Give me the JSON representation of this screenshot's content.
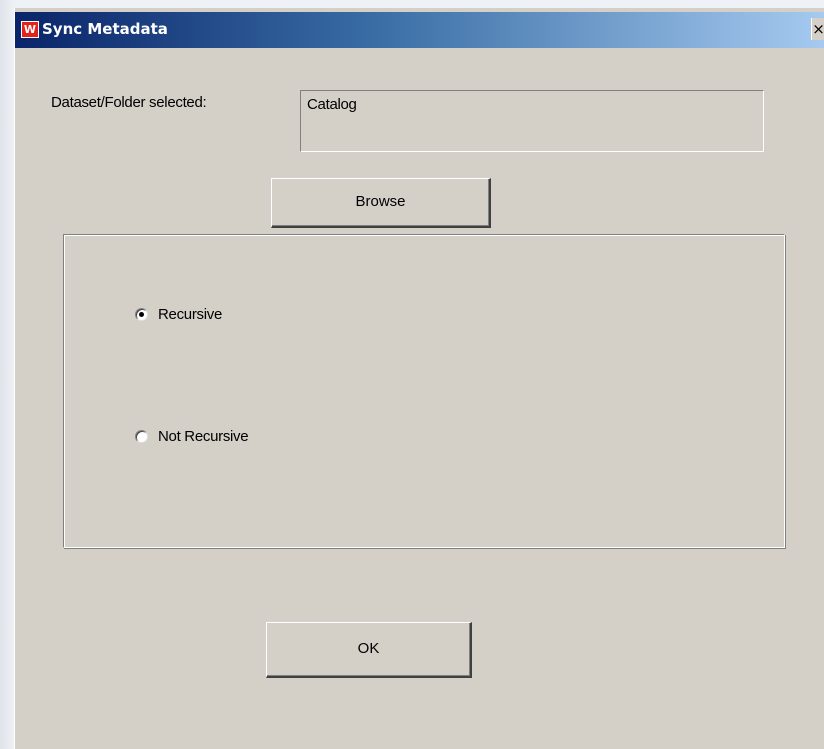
{
  "window": {
    "title": "Sync Metadata",
    "app_icon_glyph": "W",
    "close_glyph": "×"
  },
  "form": {
    "selected_label": "Dataset/Folder selected:",
    "selected_value": "Catalog",
    "browse_label": "Browse",
    "ok_label": "OK"
  },
  "options": {
    "recursive_label": "Recursive",
    "not_recursive_label": "Not Recursive",
    "selected": "Recursive"
  },
  "colors": {
    "title_bar_start": "#0a246a",
    "title_bar_end": "#a6caf0",
    "dialog_face": "#d4d0c8",
    "app_icon": "#e2231a"
  },
  "icons": {
    "app_icon": "app-logo-icon",
    "close": "close-icon"
  }
}
